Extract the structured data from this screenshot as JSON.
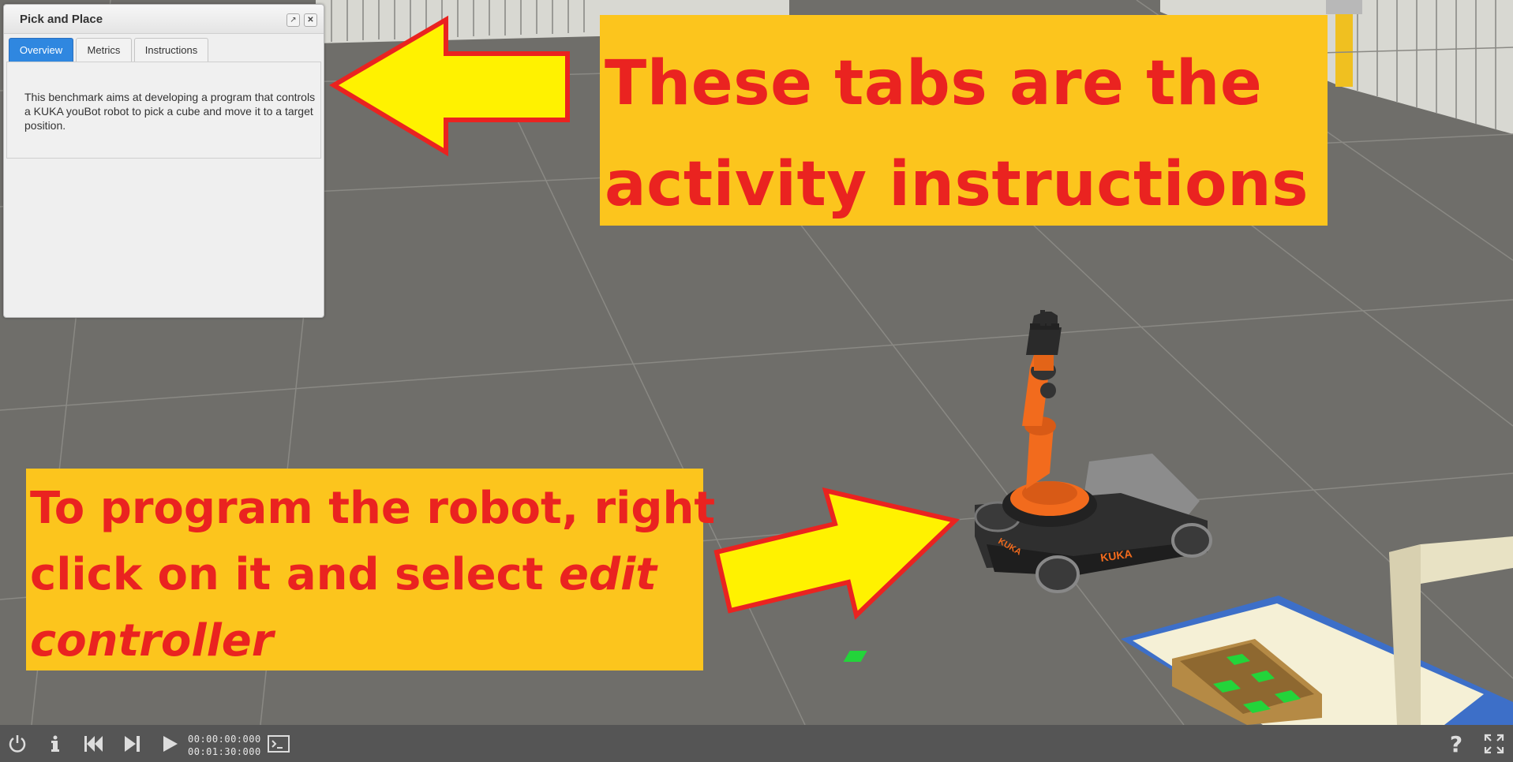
{
  "panel": {
    "title": "Pick and Place",
    "popout_icon": "external-window-icon",
    "close_icon": "close-icon",
    "tabs": [
      {
        "label": "Overview",
        "active": true
      },
      {
        "label": "Metrics",
        "active": false
      },
      {
        "label": "Instructions",
        "active": false
      }
    ],
    "overview_text": "This benchmark aims at developing a program that controls a KUKA youBot robot to pick a cube and move it to a target position."
  },
  "callouts": {
    "top": {
      "line1": "These tabs are the",
      "line2": "activity instructions"
    },
    "bottom": {
      "line1": "To program the robot, right",
      "line2_plain": "click on it and select ",
      "line2_italic": "edit",
      "line3_italic": "controller"
    }
  },
  "scene": {
    "robot_brand_front": "KUKA",
    "robot_brand_side": "KUKA"
  },
  "toolbar": {
    "time_current": "00:00:00:000",
    "time_total": "00:01:30:000",
    "icons": [
      "power-icon",
      "info-icon",
      "reset-icon",
      "step-icon",
      "play-icon",
      "console-icon",
      "help-icon",
      "fullscreen-icon"
    ]
  },
  "colors": {
    "callout_background": "#fcc51d",
    "callout_text": "#ea2320",
    "arrow_fill": "#fff200",
    "arrow_outline": "#ea2320",
    "tab_active": "#2f87e0",
    "toolbar": "#555555",
    "floor": "#6f6e6a",
    "robot_orange": "#f26b1d"
  }
}
